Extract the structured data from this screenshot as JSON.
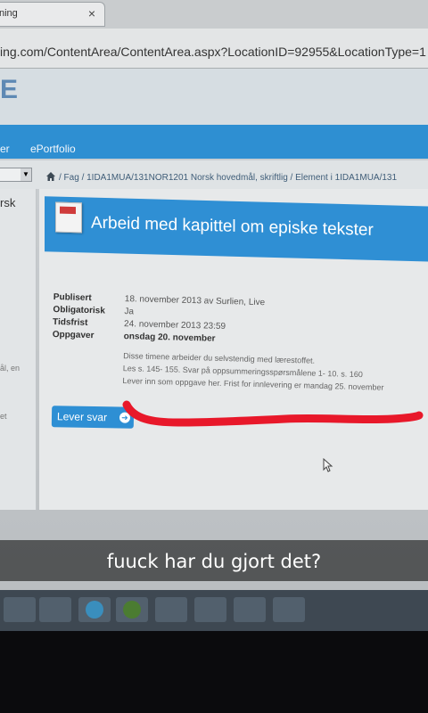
{
  "browser": {
    "tab_title": "ning",
    "tab_close": "×",
    "url": "ing.com/ContentArea/ContentArea.aspx?LocationID=92955&LocationType=1"
  },
  "header": {
    "logo_fragment": "E"
  },
  "navbar": {
    "item_1": "er",
    "item_2": "ePortfolio"
  },
  "breadcrumb": {
    "text": "/ Fag / 1IDA1MUA/131NOR1201 Norsk hovedmål, skriftlig / Element i 1IDA1MUA/131"
  },
  "sidebar": {
    "item_1": "rsk",
    "item_2": "ål, en",
    "item_3": "et"
  },
  "page": {
    "title": "Arbeid med kapittel om episke tekster",
    "meta": [
      {
        "label": "Publisert",
        "value": "18. november 2013 av Surlien, Live"
      },
      {
        "label": "Obligatorisk",
        "value": "Ja"
      },
      {
        "label": "Tidsfrist",
        "value": "24. november 2013 23:59"
      },
      {
        "label": "Oppgaver",
        "value": "onsdag 20. november"
      }
    ],
    "description": [
      "Disse timene arbeider du selvstendig med lærestoffet.",
      "Les s. 145- 155. Svar på oppsummeringsspørsmålene 1- 10. s. 160",
      "Lever inn som oppgave her. Frist for innlevering er mandag 25. november"
    ],
    "submit_button": "Lever svar"
  },
  "snap_caption": "fuuck har du gjort det?",
  "colors": {
    "accent_blue": "#2e8fd2",
    "scribble_red": "#e8182a"
  },
  "icons": [
    "home-icon",
    "document-icon",
    "arrow-right-icon",
    "mouse-cursor-icon",
    "dropdown-arrow-icon"
  ]
}
